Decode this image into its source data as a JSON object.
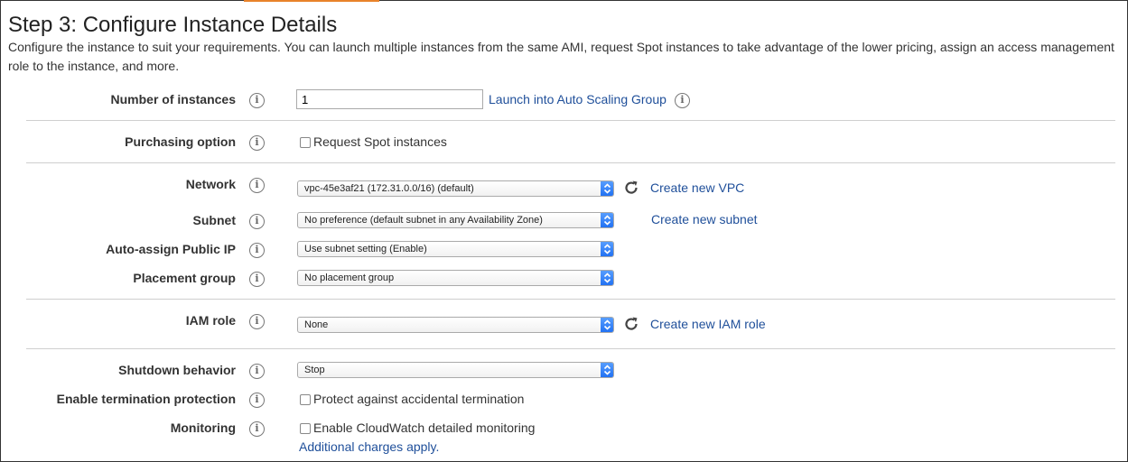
{
  "header": {
    "title": "Step 3: Configure Instance Details",
    "description": "Configure the instance to suit your requirements. You can launch multiple instances from the same AMI, request Spot instances to take advantage of the lower pricing, assign an access management role to the instance, and more."
  },
  "form": {
    "number_of_instances": {
      "label": "Number of instances",
      "value": "1",
      "link": "Launch into Auto Scaling Group"
    },
    "purchasing_option": {
      "label": "Purchasing option",
      "checkbox": "Request Spot instances",
      "checked": false
    },
    "network": {
      "label": "Network",
      "selected": "vpc-45e3af21 (172.31.0.0/16) (default)",
      "link": "Create new VPC"
    },
    "subnet": {
      "label": "Subnet",
      "selected": "No preference (default subnet in any Availability Zone)",
      "link": "Create new subnet"
    },
    "auto_assign_ip": {
      "label": "Auto-assign Public IP",
      "selected": "Use subnet setting (Enable)"
    },
    "placement_group": {
      "label": "Placement group",
      "selected": "No placement group"
    },
    "iam_role": {
      "label": "IAM role",
      "selected": "None",
      "link": "Create new IAM role"
    },
    "shutdown_behavior": {
      "label": "Shutdown behavior",
      "selected": "Stop"
    },
    "termination_protection": {
      "label": "Enable termination protection",
      "checkbox": "Protect against accidental termination",
      "checked": false
    },
    "monitoring": {
      "label": "Monitoring",
      "checkbox": "Enable CloudWatch detailed monitoring",
      "checked": false,
      "note": "Additional charges apply."
    }
  },
  "icons": {
    "info": "i"
  },
  "colors": {
    "link": "#1f4f9a",
    "select_arrow": "#1f6ff2",
    "tab_accent": "#e8832a"
  }
}
